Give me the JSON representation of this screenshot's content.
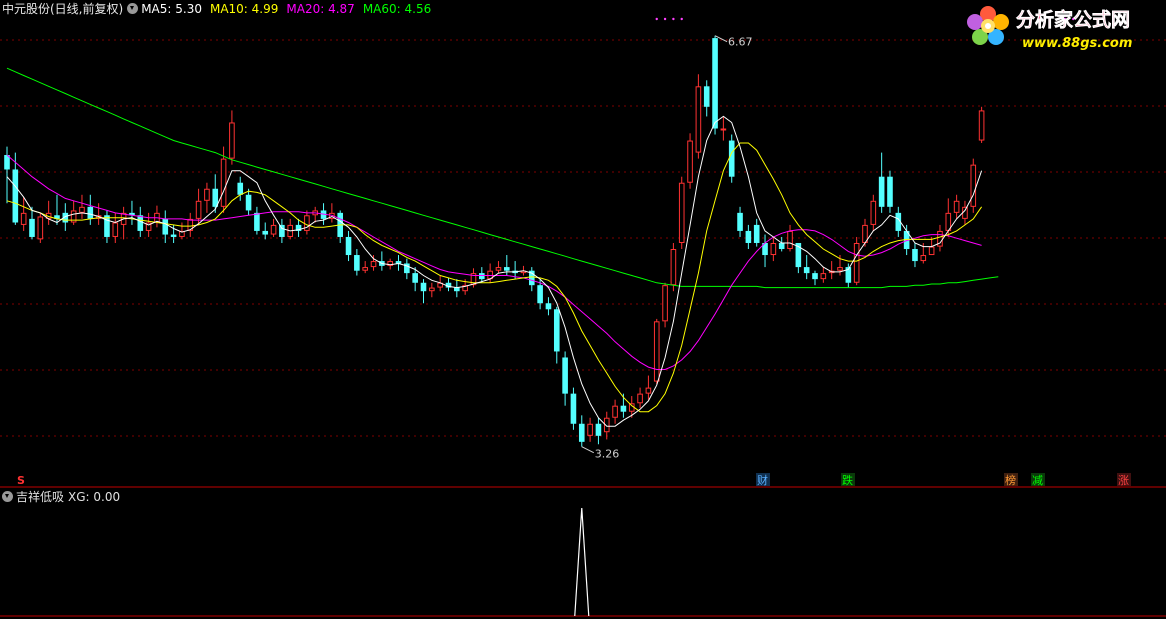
{
  "header": {
    "stock_name": "中元股份(日线,前复权)",
    "ma_labels": [
      {
        "label": "MA5: 5.30",
        "color": "#ffffff"
      },
      {
        "label": "MA10: 4.99",
        "color": "#ffff00"
      },
      {
        "label": "MA20: 4.87",
        "color": "#ff00ff"
      },
      {
        "label": "MA60: 4.56",
        "color": "#00ff00"
      }
    ]
  },
  "indicator": {
    "name": "吉祥低吸",
    "xg_label": "XG: 0.00"
  },
  "logo": {
    "brand": "分析家公式网",
    "url": "www.88gs.com"
  },
  "colors": {
    "up": "#ff3232",
    "down": "#54ffff",
    "ma5": "#ffffff",
    "ma10": "#ffff00",
    "ma20": "#ff00ff",
    "ma60": "#00ff00",
    "grid": "#800000",
    "divider": "#c00000"
  },
  "chart_data": {
    "type": "candlestick",
    "high_label": "6.67",
    "low_label": "3.26",
    "ylim": [
      3.0,
      6.85
    ],
    "grid": "dashed",
    "event_badges": [
      {
        "text": "财",
        "color": "#5ab0ff"
      },
      {
        "text": "跌",
        "color": "#00ff00"
      },
      {
        "text": "榜",
        "color": "#ff9933"
      },
      {
        "text": "减",
        "color": "#00ff00"
      },
      {
        "text": "涨",
        "color": "#ff4040"
      }
    ],
    "candles": [
      [
        5.68,
        5.56,
        5.75,
        5.28
      ],
      [
        5.56,
        5.12,
        5.7,
        5.1
      ],
      [
        5.1,
        5.2,
        5.33,
        5.05
      ],
      [
        5.15,
        5.0,
        5.25,
        4.98
      ],
      [
        4.98,
        5.17,
        5.2,
        4.95
      ],
      [
        5.15,
        5.2,
        5.3,
        5.1
      ],
      [
        5.18,
        5.15,
        5.35,
        5.1
      ],
      [
        5.2,
        5.12,
        5.28,
        5.05
      ],
      [
        5.12,
        5.22,
        5.3,
        5.1
      ],
      [
        5.2,
        5.25,
        5.35,
        5.15
      ],
      [
        5.25,
        5.15,
        5.35,
        5.1
      ],
      [
        5.15,
        5.18,
        5.28,
        5.1
      ],
      [
        5.18,
        5.0,
        5.22,
        4.95
      ],
      [
        5.0,
        5.12,
        5.2,
        4.95
      ],
      [
        5.1,
        5.2,
        5.25,
        4.98
      ],
      [
        5.2,
        5.18,
        5.3,
        5.1
      ],
      [
        5.18,
        5.05,
        5.25,
        5.0
      ],
      [
        5.05,
        5.12,
        5.2,
        5.0
      ],
      [
        5.12,
        5.2,
        5.26,
        5.08
      ],
      [
        5.15,
        5.02,
        5.22,
        4.95
      ],
      [
        5.02,
        5.0,
        5.1,
        4.95
      ],
      [
        5.0,
        5.05,
        5.12,
        4.98
      ],
      [
        5.05,
        5.15,
        5.2,
        5.0
      ],
      [
        5.15,
        5.3,
        5.4,
        5.1
      ],
      [
        5.3,
        5.4,
        5.45,
        5.2
      ],
      [
        5.4,
        5.25,
        5.52,
        5.2
      ],
      [
        5.25,
        5.65,
        5.75,
        5.2
      ],
      [
        5.65,
        5.95,
        6.05,
        5.6
      ],
      [
        5.45,
        5.35,
        5.5,
        5.3
      ],
      [
        5.35,
        5.22,
        5.4,
        5.18
      ],
      [
        5.2,
        5.05,
        5.25,
        5.02
      ],
      [
        5.05,
        5.02,
        5.12,
        4.98
      ],
      [
        5.02,
        5.1,
        5.15,
        5.0
      ],
      [
        5.1,
        5.0,
        5.15,
        4.95
      ],
      [
        5.0,
        5.1,
        5.15,
        4.98
      ],
      [
        5.1,
        5.05,
        5.15,
        5.0
      ],
      [
        5.05,
        5.18,
        5.22,
        5.02
      ],
      [
        5.18,
        5.22,
        5.25,
        5.12
      ],
      [
        5.22,
        5.15,
        5.28,
        5.1
      ],
      [
        5.15,
        5.2,
        5.28,
        5.12
      ],
      [
        5.2,
        5.0,
        5.22,
        4.95
      ],
      [
        5.0,
        4.85,
        5.05,
        4.8
      ],
      [
        4.85,
        4.72,
        4.9,
        4.68
      ],
      [
        4.72,
        4.75,
        4.8,
        4.7
      ],
      [
        4.75,
        4.8,
        4.85,
        4.72
      ],
      [
        4.8,
        4.76,
        4.88,
        4.72
      ],
      [
        4.76,
        4.8,
        4.82,
        4.73
      ],
      [
        4.8,
        4.78,
        4.85,
        4.72
      ],
      [
        4.78,
        4.7,
        4.82,
        4.65
      ],
      [
        4.7,
        4.62,
        4.75,
        4.55
      ],
      [
        4.62,
        4.55,
        4.65,
        4.45
      ],
      [
        4.55,
        4.58,
        4.62,
        4.5
      ],
      [
        4.58,
        4.62,
        4.68,
        4.55
      ],
      [
        4.62,
        4.58,
        4.66,
        4.55
      ],
      [
        4.58,
        4.55,
        4.65,
        4.5
      ],
      [
        4.55,
        4.6,
        4.65,
        4.52
      ],
      [
        4.6,
        4.7,
        4.74,
        4.58
      ],
      [
        4.7,
        4.65,
        4.75,
        4.62
      ],
      [
        4.65,
        4.72,
        4.78,
        4.62
      ],
      [
        4.72,
        4.75,
        4.8,
        4.7
      ],
      [
        4.75,
        4.72,
        4.85,
        4.68
      ],
      [
        4.72,
        4.7,
        4.8,
        4.65
      ],
      [
        4.7,
        4.72,
        4.76,
        4.68
      ],
      [
        4.72,
        4.6,
        4.75,
        4.55
      ],
      [
        4.6,
        4.45,
        4.65,
        4.4
      ],
      [
        4.45,
        4.4,
        4.5,
        4.35
      ],
      [
        4.4,
        4.05,
        4.42,
        3.95
      ],
      [
        4.0,
        3.7,
        4.05,
        3.6
      ],
      [
        3.7,
        3.45,
        3.75,
        3.4
      ],
      [
        3.45,
        3.3,
        3.52,
        3.26
      ],
      [
        3.35,
        3.45,
        3.5,
        3.3
      ],
      [
        3.45,
        3.35,
        3.5,
        3.28
      ],
      [
        3.38,
        3.5,
        3.55,
        3.32
      ],
      [
        3.5,
        3.6,
        3.65,
        3.45
      ],
      [
        3.6,
        3.55,
        3.7,
        3.5
      ],
      [
        3.55,
        3.62,
        3.68,
        3.5
      ],
      [
        3.62,
        3.7,
        3.75,
        3.58
      ],
      [
        3.7,
        3.75,
        3.85,
        3.65
      ],
      [
        3.8,
        4.3,
        4.32,
        3.78
      ],
      [
        4.3,
        4.6,
        4.62,
        4.25
      ],
      [
        4.6,
        4.9,
        4.95,
        4.55
      ],
      [
        4.95,
        5.45,
        5.5,
        4.9
      ],
      [
        5.45,
        5.8,
        5.86,
        5.4
      ],
      [
        5.7,
        6.25,
        6.35,
        5.65
      ],
      [
        6.25,
        6.08,
        6.3,
        6.0
      ],
      [
        6.65,
        5.9,
        6.67,
        5.85
      ],
      [
        5.9,
        5.9,
        6.0,
        5.8
      ],
      [
        5.8,
        5.5,
        5.85,
        5.45
      ],
      [
        5.2,
        5.05,
        5.25,
        5.0
      ],
      [
        5.05,
        4.95,
        5.1,
        4.9
      ],
      [
        5.1,
        4.95,
        5.15,
        4.92
      ],
      [
        4.95,
        4.85,
        5.02,
        4.75
      ],
      [
        4.85,
        4.95,
        5.0,
        4.8
      ],
      [
        4.95,
        4.9,
        5.0,
        4.88
      ],
      [
        4.9,
        5.05,
        5.1,
        4.88
      ],
      [
        4.95,
        4.75,
        4.95,
        4.7
      ],
      [
        4.75,
        4.7,
        4.85,
        4.65
      ],
      [
        4.7,
        4.65,
        4.72,
        4.6
      ],
      [
        4.65,
        4.7,
        4.75,
        4.62
      ],
      [
        4.7,
        4.72,
        4.8,
        4.65
      ],
      [
        4.72,
        4.75,
        4.85,
        4.68
      ],
      [
        4.75,
        4.62,
        4.78,
        4.58
      ],
      [
        4.62,
        4.95,
        5.0,
        4.6
      ],
      [
        4.95,
        5.1,
        5.15,
        4.92
      ],
      [
        5.1,
        5.3,
        5.35,
        5.05
      ],
      [
        5.5,
        5.25,
        5.7,
        5.2
      ],
      [
        5.5,
        5.25,
        5.55,
        5.2
      ],
      [
        5.2,
        5.05,
        5.25,
        5.0
      ],
      [
        5.05,
        4.9,
        5.1,
        4.85
      ],
      [
        4.9,
        4.8,
        4.95,
        4.75
      ],
      [
        4.8,
        4.85,
        4.95,
        4.78
      ],
      [
        4.85,
        4.92,
        5.0,
        4.85
      ],
      [
        4.92,
        5.05,
        5.1,
        4.88
      ],
      [
        5.05,
        5.2,
        5.32,
        5.0
      ],
      [
        5.2,
        5.3,
        5.35,
        5.15
      ],
      [
        5.15,
        5.25,
        5.3,
        5.1
      ],
      [
        5.25,
        5.6,
        5.65,
        5.2
      ],
      [
        5.8,
        6.05,
        6.08,
        5.78
      ]
    ],
    "ma5": [
      5.5,
      5.42,
      5.33,
      5.22,
      5.2,
      5.15,
      5.12,
      5.17,
      5.19,
      5.2,
      5.19,
      5.17,
      5.14,
      5.12,
      5.15,
      5.16,
      5.13,
      5.1,
      5.13,
      5.11,
      5.07,
      5.04,
      5.06,
      5.11,
      5.17,
      5.23,
      5.38,
      5.55,
      5.55,
      5.5,
      5.45,
      5.3,
      5.18,
      5.07,
      5.05,
      5.06,
      5.08,
      5.13,
      5.14,
      5.17,
      5.13,
      5.08,
      5.0,
      4.9,
      4.82,
      4.78,
      4.77,
      4.78,
      4.76,
      4.73,
      4.68,
      4.64,
      4.62,
      4.59,
      4.58,
      4.59,
      4.61,
      4.63,
      4.65,
      4.7,
      4.71,
      4.71,
      4.72,
      4.7,
      4.65,
      4.58,
      4.45,
      4.25,
      4.0,
      3.78,
      3.62,
      3.5,
      3.43,
      3.43,
      3.48,
      3.52,
      3.57,
      3.64,
      3.77,
      4.0,
      4.3,
      4.7,
      5.1,
      5.5,
      5.8,
      5.95,
      6.0,
      5.95,
      5.75,
      5.5,
      5.2,
      5.05,
      5.0,
      4.95,
      4.95,
      4.92,
      4.88,
      4.82,
      4.75,
      4.71,
      4.71,
      4.73,
      4.85,
      4.95,
      5.05,
      5.1,
      5.18,
      5.15,
      5.05,
      4.95,
      4.92,
      4.92,
      4.95,
      5.05,
      5.15,
      5.22,
      5.35,
      5.55
    ],
    "ma10": [
      5.3,
      5.28,
      5.25,
      5.22,
      5.2,
      5.17,
      5.15,
      5.14,
      5.14,
      5.14,
      5.15,
      5.16,
      5.16,
      5.16,
      5.16,
      5.15,
      5.14,
      5.13,
      5.12,
      5.11,
      5.1,
      5.09,
      5.09,
      5.1,
      5.12,
      5.15,
      5.22,
      5.3,
      5.35,
      5.38,
      5.37,
      5.35,
      5.3,
      5.25,
      5.2,
      5.14,
      5.1,
      5.08,
      5.08,
      5.09,
      5.1,
      5.1,
      5.08,
      5.02,
      4.97,
      4.93,
      4.9,
      4.87,
      4.83,
      4.8,
      4.76,
      4.72,
      4.68,
      4.66,
      4.64,
      4.63,
      4.62,
      4.62,
      4.62,
      4.63,
      4.64,
      4.65,
      4.66,
      4.67,
      4.66,
      4.64,
      4.59,
      4.5,
      4.37,
      4.22,
      4.1,
      3.98,
      3.87,
      3.76,
      3.67,
      3.6,
      3.55,
      3.55,
      3.6,
      3.7,
      3.87,
      4.1,
      4.4,
      4.7,
      5.05,
      5.3,
      5.55,
      5.7,
      5.78,
      5.78,
      5.72,
      5.6,
      5.48,
      5.35,
      5.2,
      5.1,
      5.02,
      4.96,
      4.9,
      4.86,
      4.82,
      4.8,
      4.8,
      4.83,
      4.88,
      4.92,
      4.95,
      4.97,
      4.98,
      4.98,
      4.98,
      4.98,
      5.0,
      5.02,
      5.05,
      5.1,
      5.15,
      5.25
    ],
    "ma20": [
      5.68,
      5.62,
      5.56,
      5.5,
      5.45,
      5.4,
      5.36,
      5.32,
      5.3,
      5.28,
      5.26,
      5.24,
      5.22,
      5.2,
      5.19,
      5.18,
      5.17,
      5.16,
      5.16,
      5.15,
      5.15,
      5.15,
      5.14,
      5.14,
      5.14,
      5.14,
      5.15,
      5.16,
      5.17,
      5.18,
      5.19,
      5.2,
      5.21,
      5.21,
      5.21,
      5.21,
      5.2,
      5.2,
      5.19,
      5.18,
      5.15,
      5.12,
      5.08,
      5.04,
      5.0,
      4.96,
      4.92,
      4.88,
      4.85,
      4.82,
      4.79,
      4.76,
      4.73,
      4.71,
      4.7,
      4.69,
      4.68,
      4.68,
      4.68,
      4.68,
      4.68,
      4.67,
      4.66,
      4.64,
      4.62,
      4.59,
      4.55,
      4.5,
      4.44,
      4.38,
      4.32,
      4.26,
      4.2,
      4.13,
      4.07,
      4.01,
      3.96,
      3.92,
      3.9,
      3.9,
      3.93,
      3.98,
      4.05,
      4.14,
      4.25,
      4.36,
      4.48,
      4.6,
      4.7,
      4.8,
      4.88,
      4.95,
      5.0,
      5.03,
      5.05,
      5.06,
      5.06,
      5.05,
      5.02,
      4.98,
      4.93,
      4.88,
      4.85,
      4.84,
      4.85,
      4.87,
      4.9,
      4.94,
      4.97,
      4.99,
      5.01,
      5.02,
      5.02,
      5.01,
      4.99,
      4.97,
      4.95,
      4.93
    ],
    "ma60": [
      6.4,
      6.37,
      6.34,
      6.31,
      6.28,
      6.25,
      6.22,
      6.19,
      6.16,
      6.13,
      6.1,
      6.07,
      6.04,
      6.01,
      5.98,
      5.95,
      5.92,
      5.89,
      5.86,
      5.83,
      5.8,
      5.78,
      5.76,
      5.74,
      5.72,
      5.7,
      5.67,
      5.64,
      5.62,
      5.6,
      5.58,
      5.56,
      5.54,
      5.52,
      5.5,
      5.48,
      5.46,
      5.44,
      5.42,
      5.4,
      5.38,
      5.36,
      5.34,
      5.32,
      5.3,
      5.28,
      5.26,
      5.24,
      5.22,
      5.2,
      5.18,
      5.16,
      5.14,
      5.12,
      5.1,
      5.08,
      5.06,
      5.04,
      5.02,
      5.0,
      4.98,
      4.96,
      4.94,
      4.92,
      4.9,
      4.88,
      4.86,
      4.84,
      4.82,
      4.8,
      4.78,
      4.76,
      4.74,
      4.72,
      4.7,
      4.68,
      4.66,
      4.64,
      4.62,
      4.61,
      4.6,
      4.59,
      4.59,
      4.59,
      4.59,
      4.59,
      4.59,
      4.59,
      4.59,
      4.59,
      4.59,
      4.58,
      4.58,
      4.58,
      4.58,
      4.58,
      4.58,
      4.58,
      4.58,
      4.58,
      4.58,
      4.58,
      4.58,
      4.58,
      4.58,
      4.58,
      4.59,
      4.59,
      4.59,
      4.6,
      4.6,
      4.61,
      4.61,
      4.62,
      4.62,
      4.63,
      4.64,
      4.65,
      4.66,
      4.67
    ],
    "xg_signal_index": 69
  }
}
